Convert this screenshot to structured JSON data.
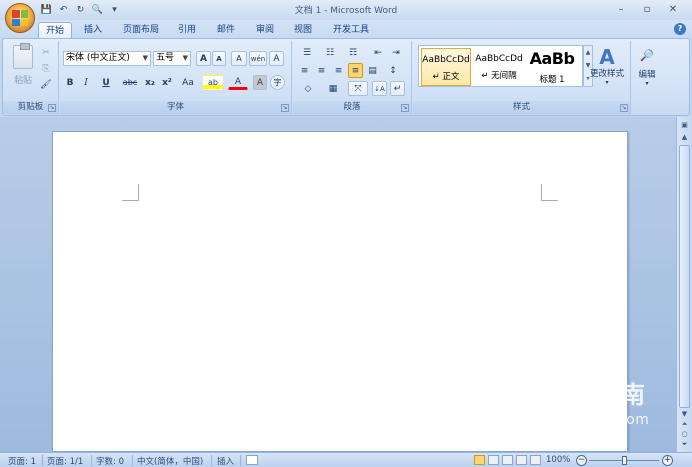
{
  "window": {
    "title": "文档 1 - Microsoft Word",
    "controls": [
      "–",
      "▫",
      "✕"
    ]
  },
  "qat": {
    "save": "💾",
    "undo": "↶",
    "redo": "↻",
    "preview": "🔍",
    "more": "▾"
  },
  "tabs": [
    {
      "label": "开始",
      "active": true
    },
    {
      "label": "插入"
    },
    {
      "label": "页面布局"
    },
    {
      "label": "引用"
    },
    {
      "label": "邮件"
    },
    {
      "label": "审阅"
    },
    {
      "label": "视图"
    },
    {
      "label": "开发工具"
    }
  ],
  "help": "?",
  "ribbon": {
    "clipboard": {
      "label": "剪贴板",
      "paste": "粘贴",
      "cut": "✂",
      "copy": "⎘",
      "format_painter": "🖌"
    },
    "font": {
      "label": "字体",
      "font_name": "宋体 (中文正文)",
      "font_size": "五号",
      "grow": "A",
      "shrink": "A",
      "clear": "A",
      "phonetic": "wén",
      "border_char": "A",
      "bold": "B",
      "italic": "I",
      "underline": "U",
      "strike": "abc",
      "subscript": "x₂",
      "superscript": "x²",
      "change_case": "Aa",
      "highlight": "ab",
      "font_color": "A",
      "shade": "A",
      "enclose": "字"
    },
    "paragraph": {
      "label": "段落",
      "bullets": "☰",
      "numbering": "☷",
      "multilevel": "☶",
      "decrease_indent": "⇤",
      "increase_indent": "⇥",
      "align_left": "≡",
      "center": "≡",
      "align_right": "≡",
      "justify": "≡",
      "distributed": "▤",
      "line_spacing": "↕",
      "shading": "◇",
      "borders": "▦",
      "chinese_layout": "⤧",
      "sort": "↓A",
      "show_marks": "↵"
    },
    "styles": {
      "label": "样式",
      "items": [
        {
          "sample": "AaBbCcDd",
          "name": "↵ 正文"
        },
        {
          "sample": "AaBbCcDd",
          "name": "↵ 无间隔"
        },
        {
          "sample": "AaBb",
          "name": "标题 1"
        }
      ],
      "change_styles": "更改样式"
    },
    "editing": {
      "label": "编辑"
    }
  },
  "statusbar": {
    "page": "页面: 1",
    "pages": "页面: 1/1",
    "words": "字数: 0",
    "language": "中文(简体，中国)",
    "insert_mode": "插入",
    "zoom": "100%",
    "zoom_level": 100
  },
  "watermark": {
    "main": "搜狗指南",
    "sub": "zhinan.sogou.com",
    "logo": "S"
  },
  "colors": {
    "accent": "#15428b",
    "ribbon_bg": "#d4e3f6",
    "highlight": "#ffff00",
    "font_color": "#ff0000"
  }
}
